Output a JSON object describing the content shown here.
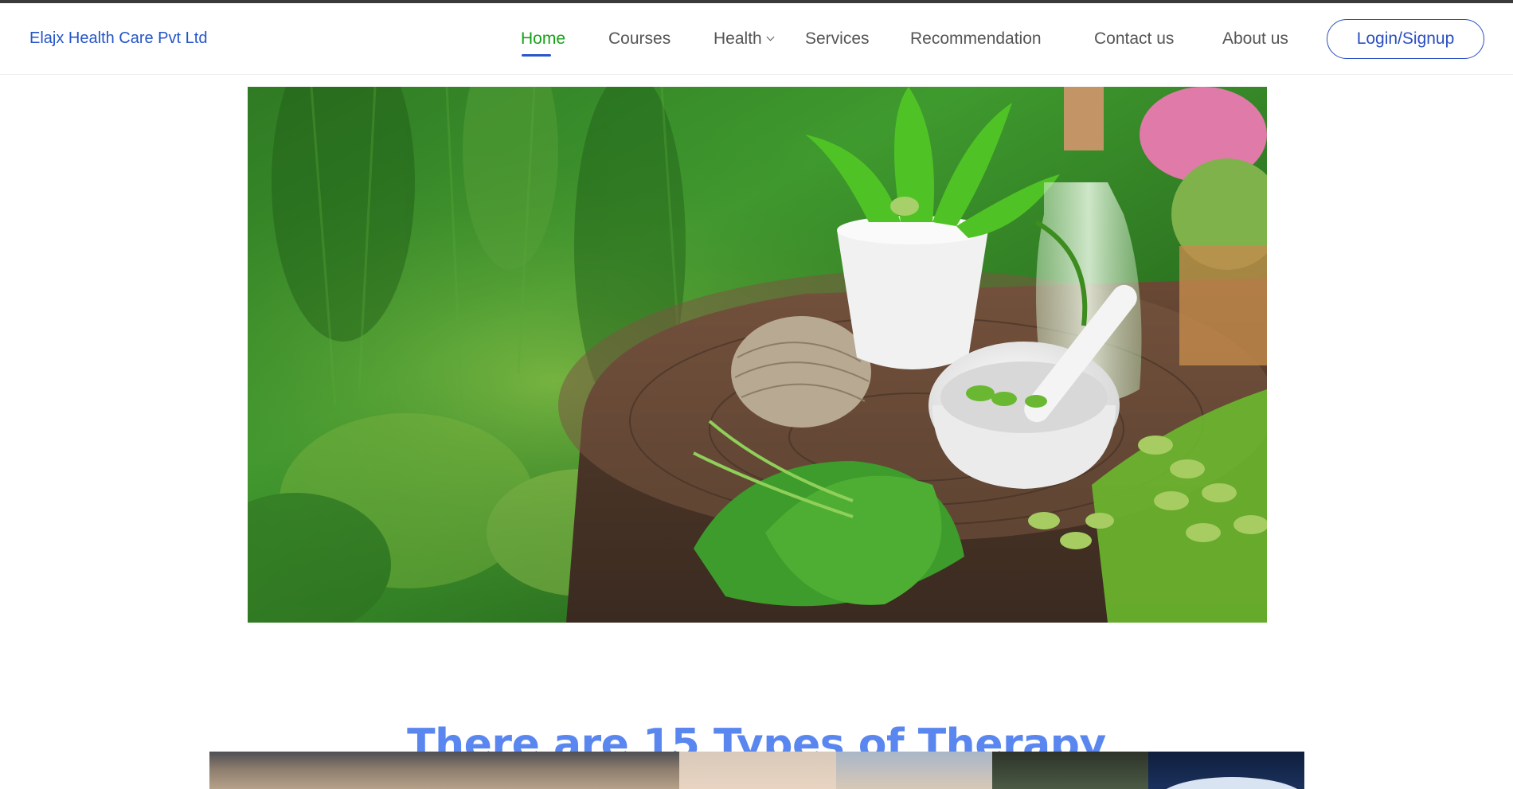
{
  "header": {
    "brand": "Elajx Health Care Pvt Ltd",
    "nav": [
      {
        "label": "Home",
        "active": true
      },
      {
        "label": "Courses"
      },
      {
        "label": "Health",
        "has_dropdown": true
      },
      {
        "label": "Services"
      },
      {
        "label": "Recommendation"
      },
      {
        "label": "Contact us"
      },
      {
        "label": "About us"
      }
    ],
    "login_label": "Login/Signup"
  },
  "hero": {
    "image": "herbal-medicine-photo"
  },
  "section": {
    "title": "There are 15 Types of Therapy"
  },
  "colors": {
    "brand": "#2455c9",
    "active_nav": "#16a316",
    "title": "#5a86ef",
    "button_border": "#2a4fc0"
  }
}
